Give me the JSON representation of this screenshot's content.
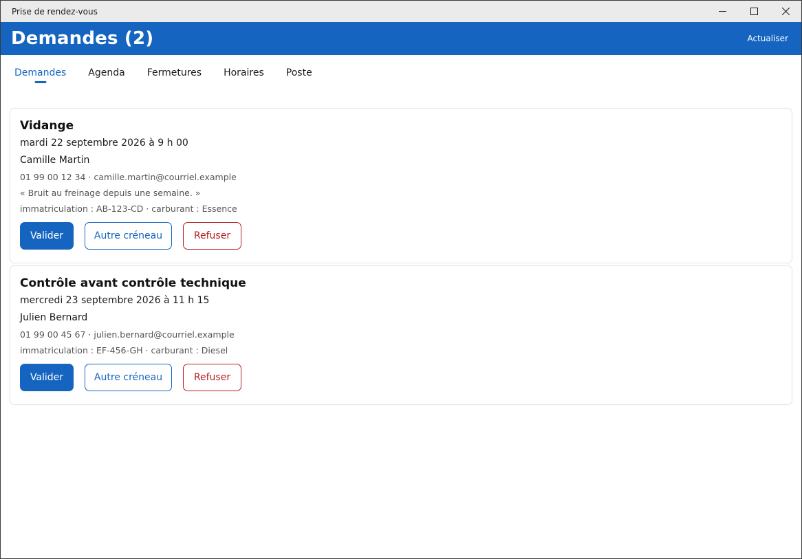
{
  "window": {
    "title": "Prise de rendez-vous",
    "controls": [
      "minimize-icon",
      "maximize-icon",
      "close-icon"
    ]
  },
  "header": {
    "title": "Demandes (2)",
    "refresh_label": "Actualiser"
  },
  "tabs": [
    {
      "label": "Demandes",
      "active": true
    },
    {
      "label": "Agenda",
      "active": false
    },
    {
      "label": "Fermetures",
      "active": false
    },
    {
      "label": "Horaires",
      "active": false
    },
    {
      "label": "Poste",
      "active": false
    }
  ],
  "requests": [
    {
      "service": "Vidange",
      "datetime": "mardi 22 septembre 2026 à 9 h 00",
      "client": "Camille Martin",
      "contact": "01 99 00 12 34 · camille.martin@courriel.example",
      "note": "« Bruit au freinage depuis une semaine. »",
      "vehicle": "immatriculation : AB-123-CD · carburant : Essence"
    },
    {
      "service": "Contrôle avant contrôle technique",
      "datetime": "mercredi 23 septembre 2026 à 11 h 15",
      "client": "Julien Bernard",
      "contact": "01 99 00 45 67 · julien.bernard@courriel.example",
      "note": "",
      "vehicle": "immatriculation : EF-456-GH · carburant : Diesel"
    }
  ],
  "actions": {
    "validate_label": "Valider",
    "reschedule_label": "Autre créneau",
    "refuse_label": "Refuser"
  },
  "colors": {
    "accent": "#1565c0",
    "danger": "#b71c1c",
    "titlebar": "#ebebeb"
  }
}
